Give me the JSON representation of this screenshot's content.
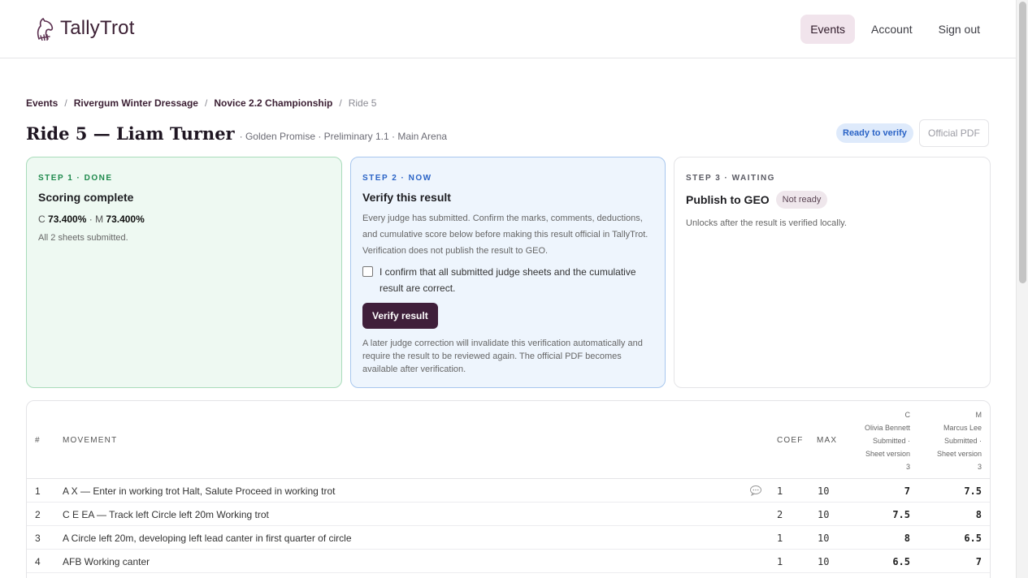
{
  "app": {
    "name": "TallyTrot"
  },
  "nav": {
    "events": "Events",
    "account": "Account",
    "signout": "Sign out"
  },
  "breadcrumb": [
    "Events",
    "Rivergum Winter Dressage",
    "Novice 2.2 Championship",
    "Ride 5"
  ],
  "title": {
    "main": "Ride 5 — Liam Turner",
    "meta": "· Golden Promise · Preliminary 1.1 · Main Arena"
  },
  "status_badge": "Ready to verify",
  "pdf_button": "Official PDF",
  "steps": {
    "s1": {
      "eyebrow": "STEP 1 · DONE",
      "heading": "Scoring complete",
      "c_label": "C",
      "c_value": "73.400%",
      "m_label": "· M",
      "m_value": "73.400%",
      "note": "All 2 sheets submitted."
    },
    "s2": {
      "eyebrow": "STEP 2 · NOW",
      "heading": "Verify this result",
      "body": "Every judge has submitted. Confirm the marks, comments, deductions, and cumulative score below before making this result official in TallyTrot. Verification does not publish the result to GEO.",
      "confirm": "I confirm that all submitted judge sheets and the cumulative result are correct.",
      "button": "Verify result",
      "note": "A later judge correction will invalidate this verification automatically and require the result to be reviewed again. The official PDF becomes available after verification."
    },
    "s3": {
      "eyebrow": "STEP 3 · WAITING",
      "heading": "Publish to GEO",
      "pill": "Not ready",
      "note": "Unlocks after the result is verified locally."
    }
  },
  "table": {
    "headers": {
      "num": "#",
      "movement": "MOVEMENT",
      "coef": "COEF",
      "max": "MAX"
    },
    "judges": [
      {
        "pos": "C",
        "name": "Olivia Bennett",
        "status": "Submitted ·",
        "version": "Sheet version",
        "version_num": "3"
      },
      {
        "pos": "M",
        "name": "Marcus Lee",
        "status": "Submitted ·",
        "version": "Sheet version",
        "version_num": "3"
      }
    ],
    "rows": [
      {
        "num": "1",
        "movement": "A X — Enter in working trot Halt, Salute Proceed in working trot",
        "coef": "1",
        "max": "10",
        "c": "7",
        "m": "7.5",
        "comment": true
      },
      {
        "num": "2",
        "movement": "C E EA — Track left Circle left 20m Working trot",
        "coef": "2",
        "max": "10",
        "c": "7.5",
        "m": "8"
      },
      {
        "num": "3",
        "movement": "A Circle left 20m, developing left lead canter in first quarter of circle",
        "coef": "1",
        "max": "10",
        "c": "8",
        "m": "6.5"
      },
      {
        "num": "4",
        "movement": "AFB Working canter",
        "coef": "1",
        "max": "10",
        "c": "6.5",
        "m": "7"
      }
    ]
  }
}
